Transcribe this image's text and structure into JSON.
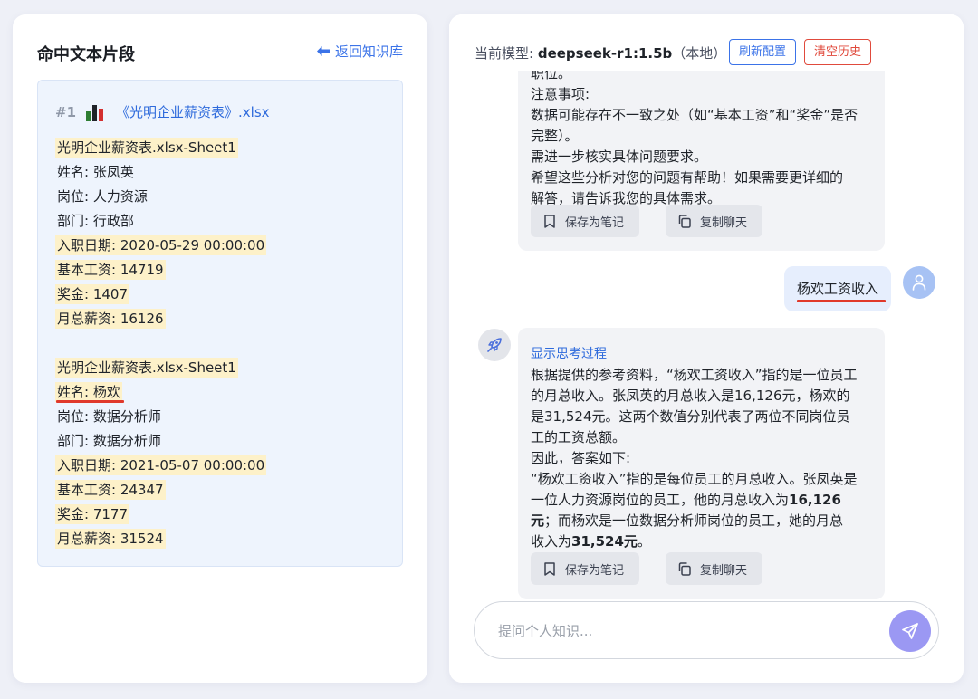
{
  "left": {
    "title": "命中文本片段",
    "back_label": "返回知识库",
    "snippet": {
      "index": "#1",
      "file_name": "《光明企业薪资表》.xlsx",
      "lines": [
        {
          "text": "光明企业薪资表.xlsx-Sheet1",
          "highlight": true
        },
        {
          "text": "姓名: 张凤英",
          "highlight": false
        },
        {
          "text": "岗位: 人力资源",
          "highlight": false
        },
        {
          "text": "部门: 行政部",
          "highlight": false
        },
        {
          "text": "入职日期: 2020-05-29 00:00:00",
          "highlight": true
        },
        {
          "text": "基本工资: 14719",
          "highlight": true
        },
        {
          "text": "奖金: 1407",
          "highlight": true
        },
        {
          "text": "月总薪资: 16126",
          "highlight": true
        },
        {
          "text": "",
          "highlight": false
        },
        {
          "text": "光明企业薪资表.xlsx-Sheet1",
          "highlight": true
        },
        {
          "text": "姓名: 杨欢",
          "highlight": true
        },
        {
          "text": "岗位: 数据分析师",
          "highlight": false
        },
        {
          "text": "部门: 数据分析师",
          "highlight": false
        },
        {
          "text": "入职日期: 2021-05-07 00:00:00",
          "highlight": true
        },
        {
          "text": "基本工资: 24347",
          "highlight": true
        },
        {
          "text": "奖金: 7177",
          "highlight": true
        },
        {
          "text": "月总薪资: 31524",
          "highlight": true
        }
      ]
    }
  },
  "right": {
    "model_prefix": "当前模型: ",
    "model_name": "deepseek-r1:1.5b",
    "model_suffix": "（本地）",
    "refresh_label": "刷新配置",
    "clear_label": "清空历史",
    "prev_answer_lines": [
      "职位。",
      "注意事项:",
      "数据可能存在不一致之处（如“基本工资”和“奖金”是否",
      "完整）。",
      "需进一步核实具体问题要求。",
      "希望这些分析对您的问题有帮助！如果需要更详细的",
      "解答，请告诉我您的具体需求。"
    ],
    "save_note_label": "保存为笔记",
    "copy_chat_label": "复制聊天",
    "user_message": "杨欢工资收入",
    "think_toggle": "显示思考过程",
    "answer_lines": [
      "根据提供的参考资料，“杨欢工资收入”指的是一位员工",
      "的月总收入。张凤英的月总收入是16,126元，杨欢的",
      "是31,524元。这两个数值分别代表了两位不同岗位员",
      "工的工资总额。",
      "因此，答案如下:",
      "“杨欢工资收入”指的是每位员工的月总收入。张凤英是",
      "一位人力资源岗位的员工，他的月总收入为"
    ],
    "answer_bold_1": "16,126",
    "answer_line8_bold": "元",
    "answer_line8_rest": "；而杨欢是一位数据分析师岗位的员工，她的月总",
    "answer_line9_plain": "收入为",
    "answer_bold_2": "31,524元",
    "answer_line9_end": "。",
    "input_placeholder": "提问个人知识..."
  },
  "colors": {
    "accent": "#3b73e8",
    "danger": "#e04a3c",
    "highlight": "#fdf1c9",
    "send_button": "#9b98f3"
  }
}
